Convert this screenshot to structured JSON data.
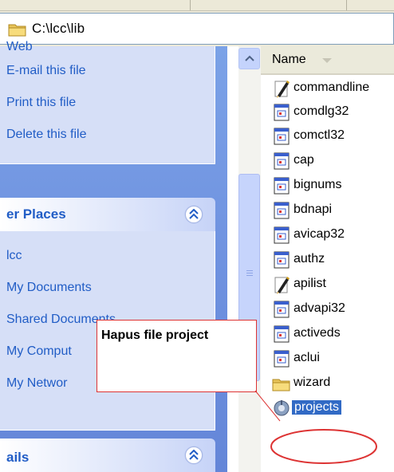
{
  "address_bar": {
    "path": "C:\\lcc\\lib",
    "icon": "folder-icon"
  },
  "left_pane": {
    "file_tasks": {
      "clipped_top_text": "Web",
      "links": [
        "E-mail this file",
        "Print this file",
        "Delete this file"
      ]
    },
    "other_places": {
      "title": "er Places",
      "collapse_icon": "chevron-up-icon",
      "links": [
        "lcc",
        "My Documents",
        "Shared Documents",
        "My Comput",
        "My Networ"
      ]
    },
    "details": {
      "title": "ails",
      "collapse_icon": "chevron-up-icon"
    }
  },
  "file_list": {
    "column_header": "Name",
    "items": [
      {
        "name": "commandline",
        "icon": "text-file-pencil-icon"
      },
      {
        "name": "comdlg32",
        "icon": "library-file-icon"
      },
      {
        "name": "comctl32",
        "icon": "library-file-icon"
      },
      {
        "name": "cap",
        "icon": "library-file-icon"
      },
      {
        "name": "bignums",
        "icon": "library-file-icon"
      },
      {
        "name": "bdnapi",
        "icon": "library-file-icon"
      },
      {
        "name": "avicap32",
        "icon": "library-file-icon"
      },
      {
        "name": "authz",
        "icon": "library-file-icon"
      },
      {
        "name": "apilist",
        "icon": "text-file-pencil-icon"
      },
      {
        "name": "advapi32",
        "icon": "library-file-icon"
      },
      {
        "name": "activeds",
        "icon": "library-file-icon"
      },
      {
        "name": "aclui",
        "icon": "library-file-icon"
      },
      {
        "name": "wizard",
        "icon": "folder-icon"
      },
      {
        "name": "projects",
        "icon": "project-file-icon",
        "selected": true
      }
    ]
  },
  "callout": {
    "text": "Hapus file project",
    "color": "#dd3333"
  },
  "colors": {
    "pane_blue": "#6f92e0",
    "link_blue": "#215dc6",
    "selection_blue": "#316ac5"
  }
}
